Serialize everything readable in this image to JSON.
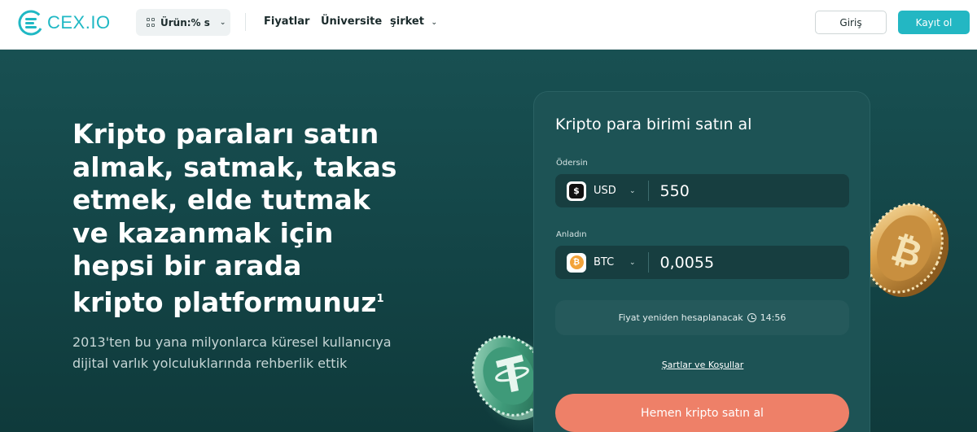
{
  "header": {
    "logo_text": "CEX.IO",
    "product_label": "Ürün:% s",
    "nav": [
      "Fiyatlar",
      "Üniversite",
      "şirket"
    ],
    "login_label": "Giriş",
    "signup_label": "Kayıt ol"
  },
  "hero": {
    "title": "Kripto paraları satın almak, satmak, takas etmek, elde tutmak ve kazanmak için hepsi bir arada kripto platformunuz",
    "title_sup": "1",
    "subtitle": "2013'ten bu yana milyonlarca küresel kullanıcıya dijital varlık yolculuklarında rehberlik ettik"
  },
  "widget": {
    "title": "Kripto para birimi satın al",
    "pay_label": "Ödersin",
    "pay_currency": "USD",
    "pay_symbol": "$",
    "pay_value": "550",
    "receive_label": "Anladın",
    "receive_currency": "BTC",
    "receive_symbol": "₿",
    "receive_value": "0,0055",
    "recalc_text": "Fiyat yeniden hesaplanacak",
    "recalc_time": "14:56",
    "terms_link": "Şartlar ve Koşullar",
    "buy_label": "Hemen kripto satın al"
  },
  "colors": {
    "brand": "#23b7c3",
    "hero_bg": "#134446",
    "cta": "#ee8068",
    "btc": "#f2a33a"
  },
  "icons": [
    "cex-logo-icon",
    "grid-icon",
    "chevron-down-icon",
    "dollar-icon",
    "bitcoin-icon",
    "clock-icon",
    "bitcoin-coin-icon",
    "tether-coin-icon"
  ]
}
